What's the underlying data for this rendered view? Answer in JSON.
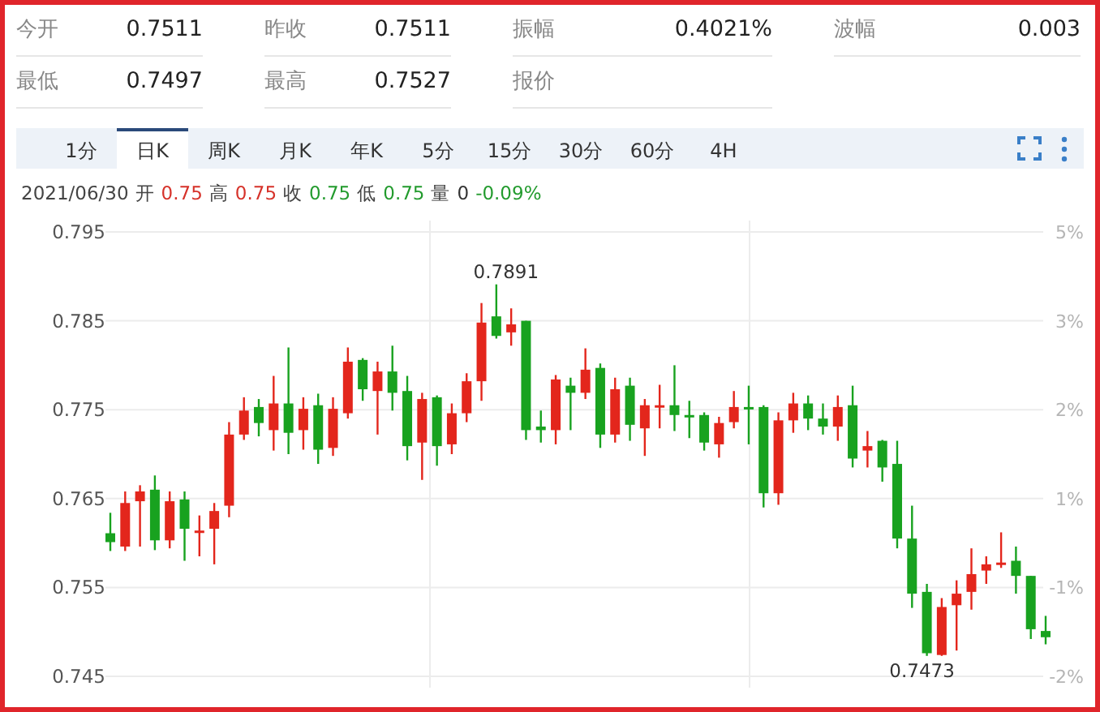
{
  "stats": [
    [
      {
        "label": "今开",
        "value": "0.7511"
      },
      {
        "label": "昨收",
        "value": "0.7511"
      },
      {
        "label": "振幅",
        "value": "0.4021%"
      },
      {
        "label": "波幅",
        "value": "0.003"
      }
    ],
    [
      {
        "label": "最低",
        "value": "0.7497"
      },
      {
        "label": "最高",
        "value": "0.7527"
      },
      {
        "label": "报价"
      }
    ]
  ],
  "tabs": [
    {
      "label": "1分",
      "selected": false
    },
    {
      "label": "日K",
      "selected": true
    },
    {
      "label": "周K",
      "selected": false
    },
    {
      "label": "月K",
      "selected": false
    },
    {
      "label": "年K",
      "selected": false
    },
    {
      "label": "5分",
      "selected": false
    },
    {
      "label": "15分",
      "selected": false
    },
    {
      "label": "30分",
      "selected": false
    },
    {
      "label": "60分",
      "selected": false
    },
    {
      "label": "4H",
      "selected": false
    }
  ],
  "info": {
    "date": "2021/06/30",
    "items": [
      {
        "label": "开",
        "value": "0.75",
        "color": "#d6322a"
      },
      {
        "label": "高",
        "value": "0.75",
        "color": "#d6322a"
      },
      {
        "label": "收",
        "value": "0.75",
        "color": "#239b2e"
      },
      {
        "label": "低",
        "value": "0.75",
        "color": "#239b2e"
      },
      {
        "label": "量",
        "value": "0",
        "color": "#333333"
      }
    ],
    "change": {
      "value": "-0.09%",
      "color": "#239b2e"
    }
  },
  "chart": {
    "right_axis_labels": [
      "5%",
      "3%",
      "2%",
      "1%",
      "-1%",
      "-2%"
    ],
    "chart_data": {
      "type": "candlestick",
      "ylim": [
        0.745,
        0.795
      ],
      "yticks": [
        0.795,
        0.785,
        0.775,
        0.765,
        0.755,
        0.745
      ],
      "grid": true,
      "ohlc": [
        [
          0.7611,
          0.7634,
          0.7591,
          0.7601
        ],
        [
          0.7596,
          0.7658,
          0.7591,
          0.7645
        ],
        [
          0.7647,
          0.7665,
          0.7596,
          0.7658
        ],
        [
          0.766,
          0.7676,
          0.7592,
          0.7603
        ],
        [
          0.7603,
          0.7658,
          0.7594,
          0.7647
        ],
        [
          0.7649,
          0.7658,
          0.758,
          0.7616
        ],
        [
          0.7612,
          0.7631,
          0.7585,
          0.7614
        ],
        [
          0.7616,
          0.7645,
          0.7576,
          0.7636
        ],
        [
          0.7642,
          0.7736,
          0.7629,
          0.7722
        ],
        [
          0.7722,
          0.7764,
          0.7716,
          0.7749
        ],
        [
          0.7753,
          0.7762,
          0.772,
          0.7735
        ],
        [
          0.7727,
          0.7788,
          0.7704,
          0.7757
        ],
        [
          0.7757,
          0.782,
          0.77,
          0.7724
        ],
        [
          0.7727,
          0.7764,
          0.7705,
          0.7751
        ],
        [
          0.7755,
          0.7768,
          0.7689,
          0.7705
        ],
        [
          0.7707,
          0.7764,
          0.7698,
          0.7751
        ],
        [
          0.7746,
          0.782,
          0.774,
          0.7804
        ],
        [
          0.7806,
          0.7808,
          0.776,
          0.7773
        ],
        [
          0.7771,
          0.7804,
          0.7722,
          0.7793
        ],
        [
          0.7793,
          0.7822,
          0.7749,
          0.7769
        ],
        [
          0.7771,
          0.7788,
          0.7693,
          0.7709
        ],
        [
          0.7713,
          0.7769,
          0.7671,
          0.7762
        ],
        [
          0.7764,
          0.7766,
          0.7687,
          0.7709
        ],
        [
          0.7711,
          0.7757,
          0.77,
          0.7746
        ],
        [
          0.7746,
          0.7791,
          0.7736,
          0.7782
        ],
        [
          0.7782,
          0.787,
          0.776,
          0.7848
        ],
        [
          0.7855,
          0.7891,
          0.783,
          0.7833
        ],
        [
          0.7837,
          0.7864,
          0.7822,
          0.7846
        ],
        [
          0.785,
          0.785,
          0.7716,
          0.7727
        ],
        [
          0.7731,
          0.7749,
          0.7713,
          0.7727
        ],
        [
          0.7727,
          0.7789,
          0.7711,
          0.7784
        ],
        [
          0.7777,
          0.7786,
          0.7727,
          0.7769
        ],
        [
          0.7769,
          0.7819,
          0.7762,
          0.7795
        ],
        [
          0.7797,
          0.7802,
          0.7707,
          0.7722
        ],
        [
          0.7722,
          0.7786,
          0.7713,
          0.7773
        ],
        [
          0.7777,
          0.7786,
          0.7715,
          0.7733
        ],
        [
          0.7729,
          0.7762,
          0.7698,
          0.7755
        ],
        [
          0.7753,
          0.7778,
          0.7729,
          0.7755
        ],
        [
          0.7755,
          0.78,
          0.7726,
          0.7744
        ],
        [
          0.7744,
          0.776,
          0.7718,
          0.7742
        ],
        [
          0.7744,
          0.7747,
          0.7704,
          0.7713
        ],
        [
          0.7711,
          0.7742,
          0.7696,
          0.7735
        ],
        [
          0.7736,
          0.7771,
          0.7729,
          0.7753
        ],
        [
          0.7753,
          0.7777,
          0.7711,
          0.7751
        ],
        [
          0.7753,
          0.7755,
          0.764,
          0.7656
        ],
        [
          0.7656,
          0.7747,
          0.7643,
          0.7738
        ],
        [
          0.7738,
          0.7769,
          0.7724,
          0.7757
        ],
        [
          0.7757,
          0.7766,
          0.7727,
          0.774
        ],
        [
          0.774,
          0.7757,
          0.7722,
          0.7731
        ],
        [
          0.7731,
          0.7766,
          0.7715,
          0.7753
        ],
        [
          0.7755,
          0.7777,
          0.7685,
          0.7695
        ],
        [
          0.7704,
          0.7726,
          0.7685,
          0.7709
        ],
        [
          0.7715,
          0.7716,
          0.7669,
          0.7685
        ],
        [
          0.7689,
          0.7715,
          0.7594,
          0.7605
        ],
        [
          0.7605,
          0.7642,
          0.7527,
          0.7543
        ],
        [
          0.7545,
          0.7554,
          0.7473,
          0.7476
        ],
        [
          0.7474,
          0.7538,
          0.7473,
          0.7528
        ],
        [
          0.753,
          0.7558,
          0.7479,
          0.7543
        ],
        [
          0.7545,
          0.7594,
          0.7525,
          0.7565
        ],
        [
          0.7569,
          0.7585,
          0.7554,
          0.7576
        ],
        [
          0.7576,
          0.7612,
          0.7572,
          0.7578
        ],
        [
          0.758,
          0.7596,
          0.7543,
          0.7563
        ],
        [
          0.7563,
          0.7563,
          0.7492,
          0.7503
        ],
        [
          0.7501,
          0.7518,
          0.7486,
          0.7494
        ]
      ],
      "annotations": [
        "0.7891",
        "0.7473"
      ]
    }
  }
}
